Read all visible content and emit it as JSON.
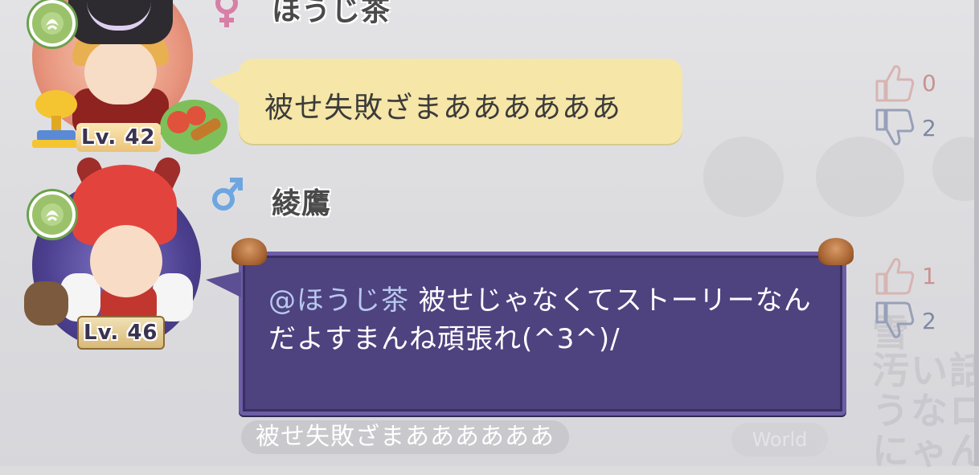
{
  "messages": [
    {
      "author": "ほうじ茶",
      "gender": "female",
      "level": "Lv. 42",
      "text": "被せ失敗ざまああああああ",
      "likes": "0",
      "dislikes": "2"
    },
    {
      "author": "綾鷹",
      "gender": "male",
      "level": "Lv. 46",
      "mention": "@ほうじ茶",
      "text": " 被せじゃなくてストーリーなんだよすまんね頑張れ(^3^)/",
      "likes": "1",
      "dislikes": "2",
      "quoted": "被せ失敗ざまああああああ"
    }
  ],
  "background": {
    "right_text_1": "汚い話",
    "right_text_2": "うなロ",
    "right_text_3": "にゃん",
    "right_text_4": "雪",
    "pill": "World"
  },
  "colors": {
    "bubble_yellow": "#f6e6a7",
    "bubble_purple": "#4e427f",
    "female_icon": "#d77fa6",
    "male_icon": "#6ea6e0",
    "like": "#c8928f",
    "dislike": "#7f88a3"
  },
  "icons": {
    "female": "female-symbol",
    "male": "male-symbol",
    "like": "thumbs-up",
    "dislike": "thumbs-down",
    "badge": "guild-emblem"
  }
}
